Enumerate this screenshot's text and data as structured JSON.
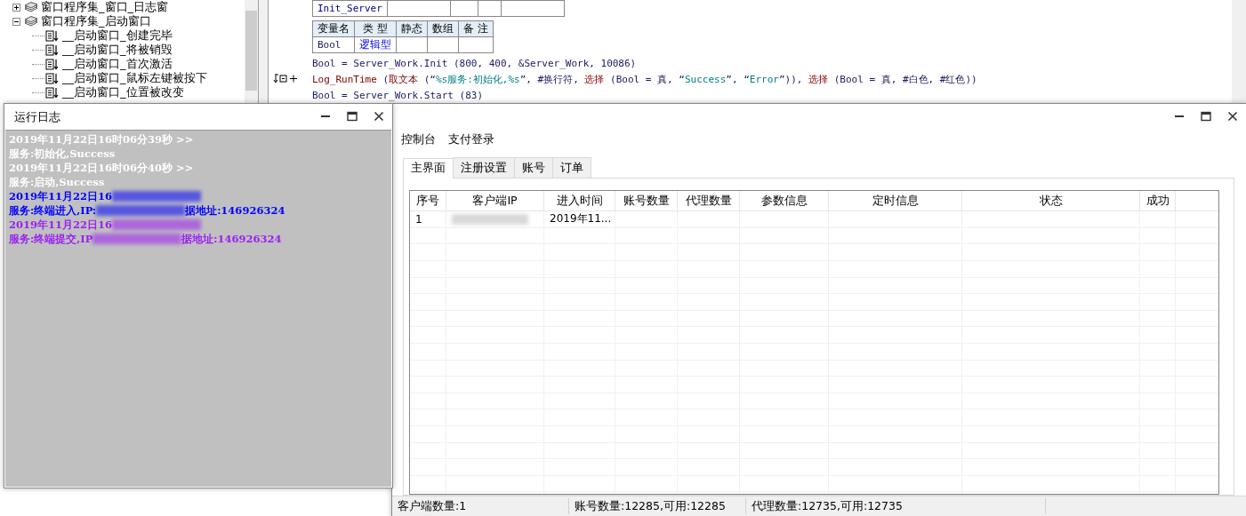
{
  "ide": {
    "tree": [
      {
        "label": "窗口程序集_窗口_日志窗",
        "expanded": false
      },
      {
        "label": "窗口程序集_启动窗口",
        "expanded": true,
        "children": [
          {
            "label": "__启动窗口_创建完毕"
          },
          {
            "label": "__启动窗口_将被销毁"
          },
          {
            "label": "__启动窗口_首次激活"
          },
          {
            "label": "__启动窗口_鼠标左键被按下"
          },
          {
            "label": "__启动窗口_位置被改变"
          }
        ]
      }
    ],
    "code": {
      "sub_table": {
        "name": "Init_Server"
      },
      "var_table": {
        "columns": [
          "变量名",
          "类 型",
          "静态",
          "数组",
          "备 注"
        ],
        "rows": [
          {
            "name": "Bool",
            "type": "逻辑型"
          }
        ]
      },
      "lines": [
        {
          "marker": false,
          "segments": [
            {
              "kind": "plain",
              "text": "Bool = Server_Work.Init (800, 400, &Server_Work, 10086)"
            }
          ]
        },
        {
          "marker": true,
          "segments": [
            {
              "kind": "cmd",
              "text": "Log_RunTime"
            },
            {
              "kind": "plain",
              "text": " ("
            },
            {
              "kind": "cmd",
              "text": "取文本"
            },
            {
              "kind": "plain",
              "text": " (“"
            },
            {
              "kind": "str",
              "text": "%s服务:初始化,%s"
            },
            {
              "kind": "plain",
              "text": "”, #换行符, "
            },
            {
              "kind": "cmd",
              "text": "选择"
            },
            {
              "kind": "plain",
              "text": " (Bool = 真, “"
            },
            {
              "kind": "str",
              "text": "Success"
            },
            {
              "kind": "plain",
              "text": "”, “"
            },
            {
              "kind": "str",
              "text": "Error"
            },
            {
              "kind": "plain",
              "text": "”)), "
            },
            {
              "kind": "cmd",
              "text": "选择"
            },
            {
              "kind": "plain",
              "text": " (Bool = 真, #白色, #红色))"
            }
          ]
        },
        {
          "marker": false,
          "segments": [
            {
              "kind": "plain",
              "text": "Bool = Server_Work.Start (83)"
            }
          ]
        }
      ]
    }
  },
  "log_window": {
    "title": "运行日志",
    "lines": [
      {
        "color": "#ffffff",
        "segments": [
          {
            "kind": "text",
            "text": "2019年11月22日16时06分39秒 >>"
          }
        ]
      },
      {
        "color": "#ffffff",
        "segments": [
          {
            "kind": "text",
            "text": "服务:初始化,Success"
          }
        ]
      },
      {
        "color": "#ffffff",
        "segments": [
          {
            "kind": "text",
            "text": "2019年11月22日16时06分40秒 >>"
          }
        ]
      },
      {
        "color": "#ffffff",
        "segments": [
          {
            "kind": "text",
            "text": "服务:启动,Success"
          }
        ]
      },
      {
        "color": "#0000ff",
        "segments": [
          {
            "kind": "text",
            "text": "2019年11月22日16"
          },
          {
            "kind": "redacted"
          }
        ]
      },
      {
        "color": "#0000ff",
        "segments": [
          {
            "kind": "text",
            "text": "服务:终端进入,IP:"
          },
          {
            "kind": "redacted"
          },
          {
            "kind": "text",
            "text": "据地址:146926324"
          }
        ]
      },
      {
        "color": "#9b1ff2",
        "segments": [
          {
            "kind": "text",
            "text": "2019年11月22日16"
          },
          {
            "kind": "redacted"
          }
        ]
      },
      {
        "color": "#9b1ff2",
        "segments": [
          {
            "kind": "text",
            "text": "服务:终端提交,IP"
          },
          {
            "kind": "redacted"
          },
          {
            "kind": "text",
            "text": "据地址:146926324"
          }
        ]
      }
    ]
  },
  "main_window": {
    "menu": [
      "控制台",
      "支付登录"
    ],
    "tabs": [
      {
        "label": "主界面",
        "selected": true
      },
      {
        "label": "注册设置",
        "selected": false
      },
      {
        "label": "账号",
        "selected": false
      },
      {
        "label": "订单",
        "selected": false
      }
    ],
    "table": {
      "columns": [
        "序号",
        "客户端IP",
        "进入时间",
        "账号数量",
        "代理数量",
        "参数信息",
        "定时信息",
        "状态",
        "成功"
      ],
      "rows": [
        {
          "cells": [
            {
              "kind": "text",
              "text": "1"
            },
            {
              "kind": "redacted"
            },
            {
              "kind": "text",
              "text": "2019年11..."
            }
          ]
        }
      ]
    },
    "status_bar": [
      "客户端数量:1",
      "账号数量:12285,可用:12285",
      "代理数量:12735,可用:12735"
    ]
  }
}
